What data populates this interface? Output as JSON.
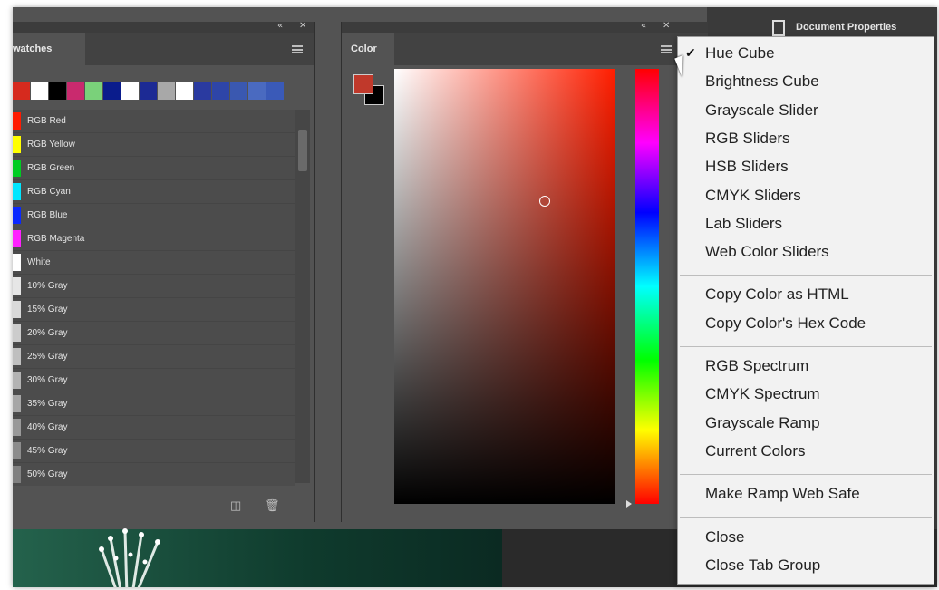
{
  "swatches_panel": {
    "tab_label": "watches",
    "swatch_colors": [
      "#d62a1e",
      "#ffffff",
      "#000000",
      "#c92a6e",
      "#7ad17a",
      "#0a1c8c",
      "#ffffff",
      "#1c2a94",
      "#a8a8a8",
      "#ffffff",
      "#2a3aa0",
      "#2e45a8",
      "#3a58b0",
      "#4a6ac0",
      "#3a5ab8"
    ],
    "items": [
      {
        "name": "RGB Red",
        "color": "#ff1a00"
      },
      {
        "name": "RGB Yellow",
        "color": "#ffff00"
      },
      {
        "name": "RGB Green",
        "color": "#00cc22"
      },
      {
        "name": "RGB Cyan",
        "color": "#00e6ff"
      },
      {
        "name": "RGB Blue",
        "color": "#0a28ff"
      },
      {
        "name": "RGB Magenta",
        "color": "#ff20ff"
      },
      {
        "name": "White",
        "color": "#ffffff"
      },
      {
        "name": "10% Gray",
        "color": "#e6e6e6"
      },
      {
        "name": "15% Gray",
        "color": "#d9d9d9"
      },
      {
        "name": "20% Gray",
        "color": "#cccccc"
      },
      {
        "name": "25% Gray",
        "color": "#bfbfbf"
      },
      {
        "name": "30% Gray",
        "color": "#b3b3b3"
      },
      {
        "name": "35% Gray",
        "color": "#a6a6a6"
      },
      {
        "name": "40% Gray",
        "color": "#999999"
      },
      {
        "name": "45% Gray",
        "color": "#8c8c8c"
      },
      {
        "name": "50% Gray",
        "color": "#808080"
      }
    ]
  },
  "color_panel": {
    "tab_label": "Color",
    "foreground_color": "#c0392b",
    "background_color": "#000000",
    "field_hue_color": "#ff1e00"
  },
  "right_panel": {
    "document_properties_label": "Document Properties"
  },
  "flyout_menu": {
    "groups": [
      {
        "items": [
          {
            "label": "Hue Cube",
            "checked": true
          },
          {
            "label": "Brightness Cube",
            "checked": false
          },
          {
            "label": "Grayscale Slider",
            "checked": false
          },
          {
            "label": "RGB Sliders",
            "checked": false
          },
          {
            "label": "HSB Sliders",
            "checked": false
          },
          {
            "label": "CMYK Sliders",
            "checked": false
          },
          {
            "label": "Lab Sliders",
            "checked": false
          },
          {
            "label": "Web Color Sliders",
            "checked": false
          }
        ]
      },
      {
        "items": [
          {
            "label": "Copy Color as HTML",
            "checked": false
          },
          {
            "label": "Copy Color's Hex Code",
            "checked": false
          }
        ]
      },
      {
        "items": [
          {
            "label": "RGB Spectrum",
            "checked": false
          },
          {
            "label": "CMYK Spectrum",
            "checked": false
          },
          {
            "label": "Grayscale Ramp",
            "checked": false
          },
          {
            "label": "Current Colors",
            "checked": false
          }
        ]
      },
      {
        "items": [
          {
            "label": "Make Ramp Web Safe",
            "checked": false
          }
        ]
      },
      {
        "items": [
          {
            "label": "Close",
            "checked": false
          },
          {
            "label": "Close Tab Group",
            "checked": false
          }
        ]
      }
    ],
    "check_glyph": "✔"
  }
}
